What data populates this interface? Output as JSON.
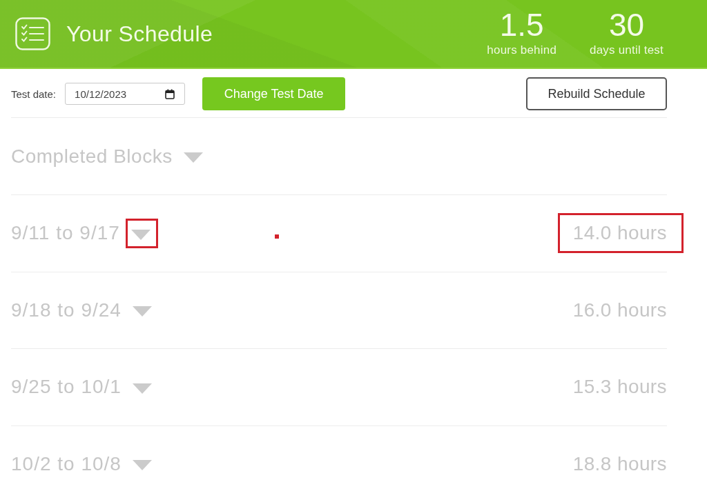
{
  "header": {
    "title": "Your Schedule",
    "stats": [
      {
        "value": "1.5",
        "label": "hours behind"
      },
      {
        "value": "30",
        "label": "days until test"
      }
    ]
  },
  "toolbar": {
    "date_label": "Test date:",
    "date_value": "10/12/2023",
    "buttons": [
      {
        "kind": "primary",
        "label": "Change Test Date"
      },
      {
        "kind": "outline",
        "label": "Rebuild Schedule"
      }
    ]
  },
  "completed_blocks": {
    "label": "Completed Blocks",
    "expanded": false
  },
  "weeks": [
    {
      "range": "9/11 to 9/17",
      "hours": "14.0 hours",
      "expanded": false,
      "highlighted": true
    },
    {
      "range": "9/18 to 9/24",
      "hours": "16.0 hours",
      "expanded": false,
      "highlighted": false
    },
    {
      "range": "9/25 to 10/1",
      "hours": "15.3 hours",
      "expanded": false,
      "highlighted": false
    },
    {
      "range": "10/2 to 10/8",
      "hours": "18.8 hours",
      "expanded": false,
      "highlighted": false
    }
  ]
}
